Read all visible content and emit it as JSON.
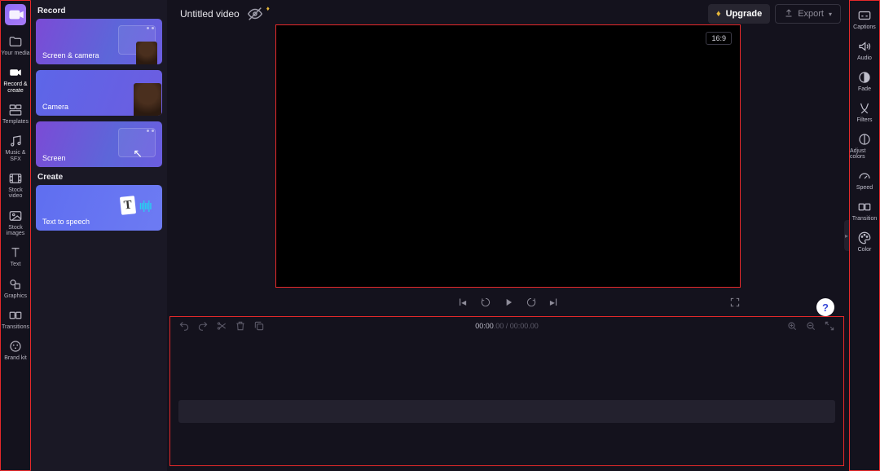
{
  "rail": {
    "items": [
      {
        "label": "Your media",
        "icon": "folder-icon"
      },
      {
        "label": "Record & create",
        "icon": "camera-icon",
        "active": true
      },
      {
        "label": "Templates",
        "icon": "templates-icon"
      },
      {
        "label": "Music & SFX",
        "icon": "music-icon"
      },
      {
        "label": "Stock video",
        "icon": "stock-video-icon"
      },
      {
        "label": "Stock images",
        "icon": "stock-images-icon"
      },
      {
        "label": "Text",
        "icon": "text-icon"
      },
      {
        "label": "Graphics",
        "icon": "graphics-icon"
      },
      {
        "label": "Transitions",
        "icon": "transitions-icon"
      },
      {
        "label": "Brand kit",
        "icon": "brandkit-icon"
      }
    ]
  },
  "panel": {
    "record_heading": "Record",
    "create_heading": "Create",
    "cards": {
      "screen_camera": "Screen & camera",
      "camera": "Camera",
      "screen": "Screen",
      "tts": "Text to speech"
    }
  },
  "topbar": {
    "title": "Untitled video",
    "upgrade": "Upgrade",
    "export": "Export"
  },
  "preview": {
    "aspect": "16:9"
  },
  "timeline": {
    "current": "00:00",
    "current_frac": ".00",
    "total": "00:00",
    "total_frac": ".00",
    "sep": " / "
  },
  "rrail": {
    "items": [
      {
        "label": "Captions",
        "icon": "captions-icon"
      },
      {
        "label": "Audio",
        "icon": "audio-icon"
      },
      {
        "label": "Fade",
        "icon": "fade-icon"
      },
      {
        "label": "Filters",
        "icon": "filters-icon"
      },
      {
        "label": "Adjust colors",
        "icon": "adjust-colors-icon"
      },
      {
        "label": "Speed",
        "icon": "speed-icon"
      },
      {
        "label": "Transition",
        "icon": "transition-icon"
      },
      {
        "label": "Color",
        "icon": "color-icon"
      }
    ]
  }
}
